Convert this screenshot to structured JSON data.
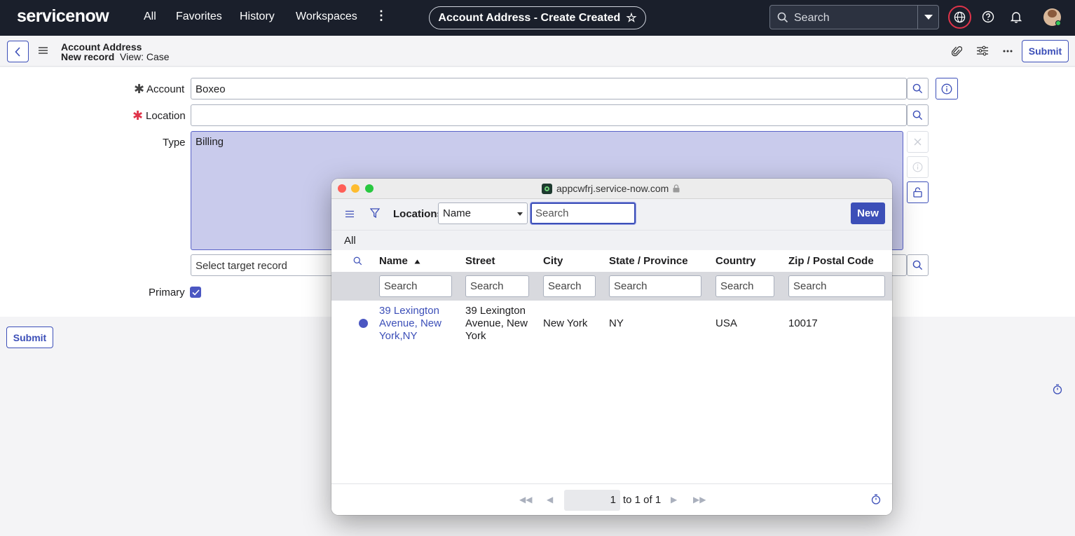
{
  "topnav": {
    "logo": "servicenow",
    "items": [
      "All",
      "Favorites",
      "History",
      "Workspaces"
    ],
    "more_icon": "more-vertical-icon",
    "page_title": "Account Address - Create Created",
    "search_placeholder": "Search"
  },
  "header": {
    "title": "Account Address",
    "subtitle_record": "New record",
    "subtitle_view": "View: Case",
    "submit_label": "Submit"
  },
  "form": {
    "account_label": "Account",
    "account_value": "Boxeo",
    "location_label": "Location",
    "location_value": "",
    "type_label": "Type",
    "type_value": "Billing",
    "target_placeholder": "Select target record",
    "primary_label": "Primary",
    "primary_checked": true,
    "submit_label": "Submit"
  },
  "popup": {
    "url": "appcwfrj.service-now.com",
    "list_title": "Locations",
    "filter_field": "Name",
    "search_placeholder": "Search",
    "new_label": "New",
    "breadcrumb": "All",
    "columns": [
      "Name",
      "Street",
      "City",
      "State / Province",
      "Country",
      "Zip / Postal Code"
    ],
    "column_search_placeholder": "Search",
    "rows": [
      {
        "name_lines": [
          "39 Lexington",
          "Avenue, New",
          "York,NY"
        ],
        "street_lines": [
          "39 Lexington",
          "Avenue, New",
          "York"
        ],
        "city": "New York",
        "state": "NY",
        "country": "USA",
        "zip": "10017"
      }
    ],
    "pagination": {
      "page": "1",
      "summary": "to 1 of 1"
    }
  },
  "colors": {
    "nav_bg": "#1a1f2b",
    "accent": "#3c4fb8",
    "required": "#e0344a",
    "textarea_bg": "#c9cbec"
  }
}
